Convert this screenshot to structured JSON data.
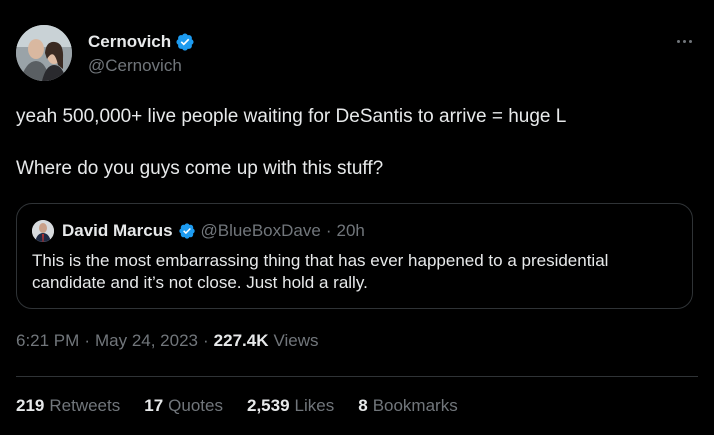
{
  "tweet": {
    "author": {
      "display_name": "Cernovich",
      "handle": "@Cernovich",
      "verified": true
    },
    "text_lines": [
      "yeah 500,000+ live people waiting for DeSantis to arrive = huge L",
      "Where do you guys come up with this stuff?"
    ],
    "quote": {
      "display_name": "David Marcus",
      "handle": "@BlueBoxDave",
      "separator": "·",
      "time": "20h",
      "text": "This is the most embarrassing thing that has ever happened to a presidential candidate and it’s not close. Just hold a rally."
    },
    "meta": {
      "time": "6:21 PM",
      "separator": "·",
      "date": "May 24, 2023",
      "separator2": "·",
      "views_count": "227.4K",
      "views_label": "Views"
    },
    "stats": [
      {
        "count": "219",
        "label": "Retweets"
      },
      {
        "count": "17",
        "label": "Quotes"
      },
      {
        "count": "2,539",
        "label": "Likes"
      },
      {
        "count": "8",
        "label": "Bookmarks"
      }
    ]
  },
  "colors": {
    "background": "#000000",
    "primary_text": "#e7e9ea",
    "secondary_text": "#71767b",
    "border": "#2f3336",
    "verified_blue": "#1d9bf0"
  },
  "icons": [
    "verified-badge-icon",
    "more-options-icon"
  ]
}
